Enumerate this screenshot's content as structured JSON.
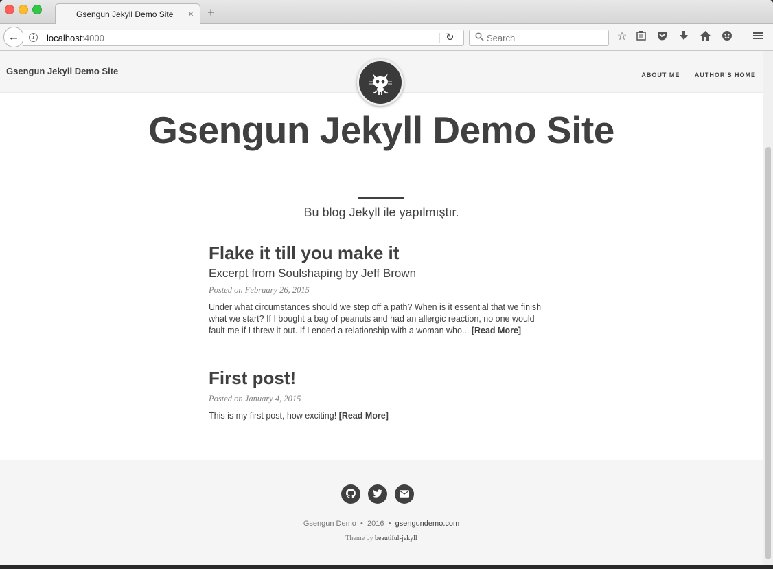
{
  "browser": {
    "tab_title": "Gsengun Jekyll Demo Site",
    "tab_close": "×",
    "new_tab": "+",
    "url_host": "localhost",
    "url_port": ":4000",
    "search_placeholder": "Search"
  },
  "site": {
    "brand": "Gsengun Jekyll Demo Site",
    "nav": [
      "ABOUT ME",
      "AUTHOR'S HOME"
    ],
    "title": "Gsengun Jekyll Demo Site",
    "subtitle": "Bu blog Jekyll ile yapılmıştır."
  },
  "posts": [
    {
      "title": "Flake it till you make it",
      "subtitle": "Excerpt from Soulshaping by Jeff Brown",
      "meta": "Posted on February 26, 2015",
      "excerpt": "Under what circumstances should we step off a path? When is it essential that we finish what we start? If I bought a bag of peanuts and had an allergic reaction, no one would fault me if I threw it out. If I ended a relationship with a woman who...",
      "read_more": "[Read More]"
    },
    {
      "title": "First post!",
      "meta": "Posted on January 4, 2015",
      "excerpt": "This is my first post, how exciting!",
      "read_more": "[Read More]"
    }
  ],
  "footer": {
    "author": "Gsengun Demo",
    "year": "2016",
    "domain": "gsengundemo.com",
    "sep": "•",
    "theme_prefix": "Theme by",
    "theme_link": "beautiful-jekyll"
  },
  "icons": {
    "github": "github-icon",
    "twitter": "twitter-icon",
    "email": "envelope-icon"
  }
}
